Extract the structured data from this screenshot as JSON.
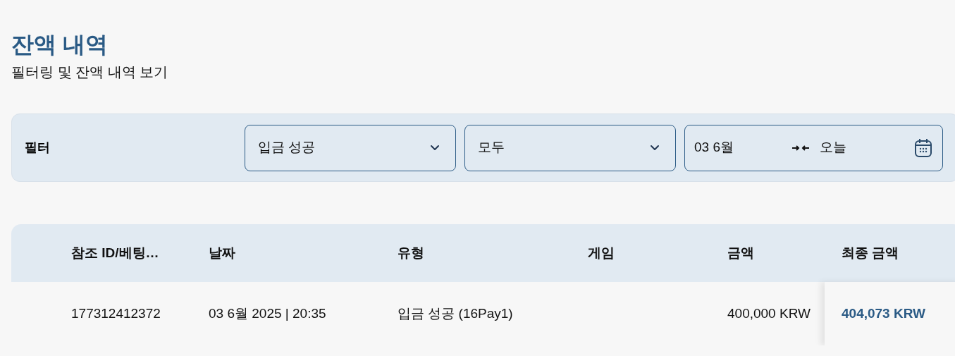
{
  "header": {
    "title": "잔액 내역",
    "subtitle": "필터링 및 잔액 내역 보기"
  },
  "filter": {
    "label": "필터",
    "selects": [
      {
        "value": "입금 성공"
      },
      {
        "value": "모두"
      }
    ],
    "date_range": {
      "from": "03 6월",
      "to": "오늘"
    }
  },
  "table": {
    "columns": [
      "참조 ID/베팅…",
      "날짜",
      "유형",
      "게임",
      "금액",
      "최종 금액"
    ],
    "rows": [
      {
        "cells": [
          "177312412372",
          "03 6월 2025 | 20:35",
          "입금 성공 (16Pay1)",
          "",
          "400,000 KRW",
          "404,073 KRW"
        ]
      }
    ]
  }
}
